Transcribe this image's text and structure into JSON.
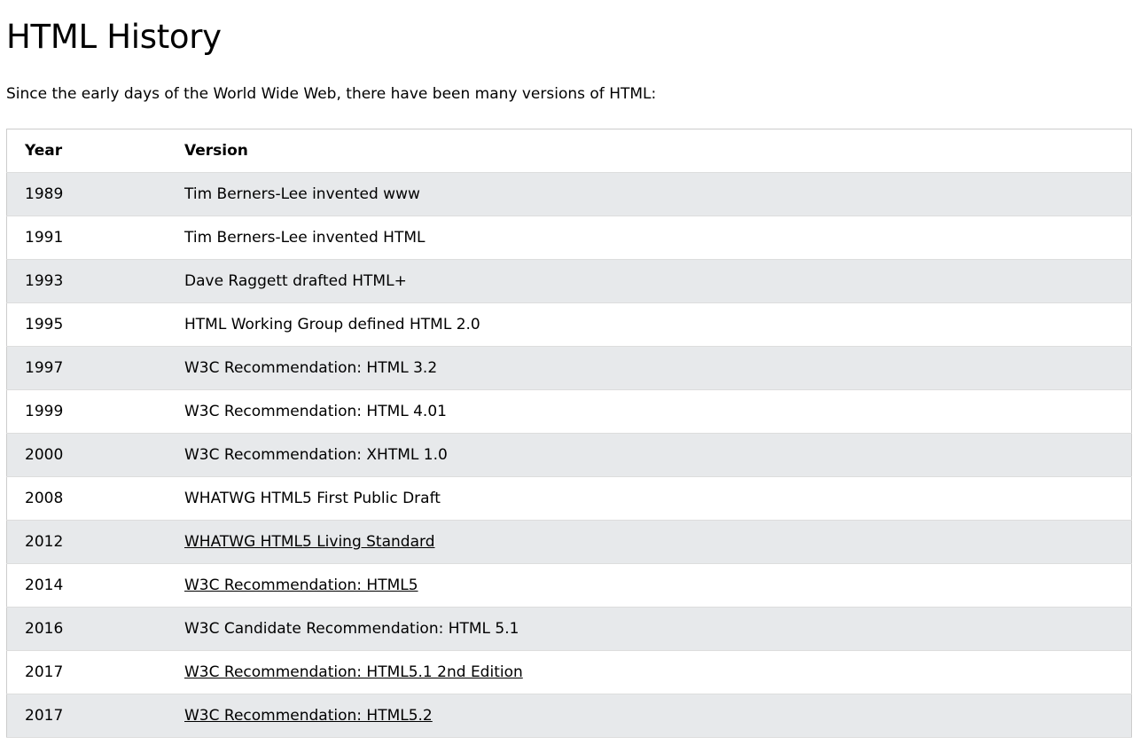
{
  "page": {
    "title": "HTML History",
    "intro": "Since the early days of the World Wide Web, there have been many versions of HTML:"
  },
  "table": {
    "headers": {
      "year": "Year",
      "version": "Version"
    },
    "rows": [
      {
        "year": "1989",
        "version": "Tim Berners-Lee invented www",
        "link": false
      },
      {
        "year": "1991",
        "version": "Tim Berners-Lee invented HTML",
        "link": false
      },
      {
        "year": "1993",
        "version": "Dave Raggett drafted HTML+",
        "link": false
      },
      {
        "year": "1995",
        "version": "HTML Working Group defined HTML 2.0",
        "link": false
      },
      {
        "year": "1997",
        "version": "W3C Recommendation: HTML 3.2",
        "link": false
      },
      {
        "year": "1999",
        "version": "W3C Recommendation: HTML 4.01",
        "link": false
      },
      {
        "year": "2000",
        "version": "W3C Recommendation: XHTML 1.0",
        "link": false
      },
      {
        "year": "2008",
        "version": "WHATWG HTML5 First Public Draft",
        "link": false
      },
      {
        "year": "2012",
        "version": "WHATWG HTML5 Living Standard",
        "link": true
      },
      {
        "year": "2014",
        "version": "W3C Recommendation: HTML5",
        "link": true
      },
      {
        "year": "2016",
        "version": "W3C Candidate Recommendation: HTML 5.1",
        "link": false
      },
      {
        "year": "2017",
        "version": "W3C Recommendation: HTML5.1 2nd Edition",
        "link": true
      },
      {
        "year": "2017",
        "version": "W3C Recommendation: HTML5.2",
        "link": true
      }
    ]
  }
}
